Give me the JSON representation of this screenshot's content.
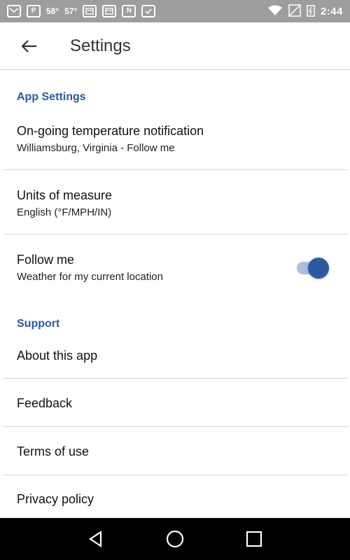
{
  "status_bar": {
    "left_icons": [
      "gmail-icon",
      "pinterest-icon",
      "weather-icon",
      "weather-icon",
      "calendar-icon",
      "calendar-icon",
      "n-icon",
      "check-icon"
    ],
    "temp1": "58°",
    "temp2": "57°",
    "time": "2:44"
  },
  "app_bar": {
    "title": "Settings"
  },
  "sections": {
    "app_settings": "App Settings",
    "support": "Support"
  },
  "items": {
    "notification": {
      "title": "On-going temperature notification",
      "subtitle": "Williamsburg, Virginia - Follow me"
    },
    "units": {
      "title": "Units of measure",
      "subtitle": "English (°F/MPH/IN)"
    },
    "follow_me": {
      "title": "Follow me",
      "subtitle": "Weather for my current location",
      "enabled": true
    },
    "about": {
      "title": "About this app"
    },
    "feedback": {
      "title": "Feedback"
    },
    "terms": {
      "title": "Terms of use"
    },
    "privacy": {
      "title": "Privacy policy"
    }
  },
  "colors": {
    "accent": "#2c5aa0",
    "status_bar": "#9e9e9e",
    "nav_bar": "#000000"
  }
}
